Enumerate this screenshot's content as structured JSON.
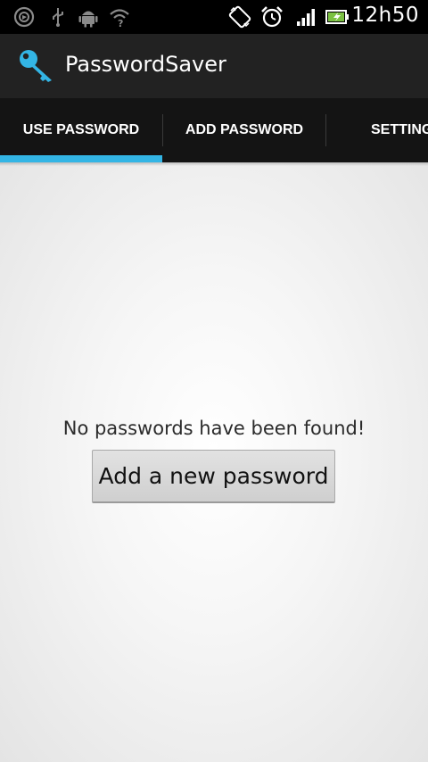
{
  "status_bar": {
    "time": "12h50",
    "icons": [
      "sync-icon",
      "usb-icon",
      "android-debug-icon",
      "wifi-icon",
      "screen-rotation-icon",
      "alarm-icon",
      "signal-icon",
      "battery-icon"
    ]
  },
  "action_bar": {
    "app_icon": "key-icon",
    "title": "PasswordSaver"
  },
  "tabs": [
    {
      "label": "USE PASSWORD",
      "selected": true
    },
    {
      "label": "ADD PASSWORD",
      "selected": false
    },
    {
      "label": "SETTINGS",
      "selected": false
    }
  ],
  "main": {
    "empty_message": "No passwords have been found!",
    "add_button_label": "Add a new password"
  },
  "colors": {
    "accent": "#33b5e5",
    "action_bar_bg": "#222222",
    "tab_bar_bg": "#141414",
    "status_bar_bg": "#000000"
  }
}
